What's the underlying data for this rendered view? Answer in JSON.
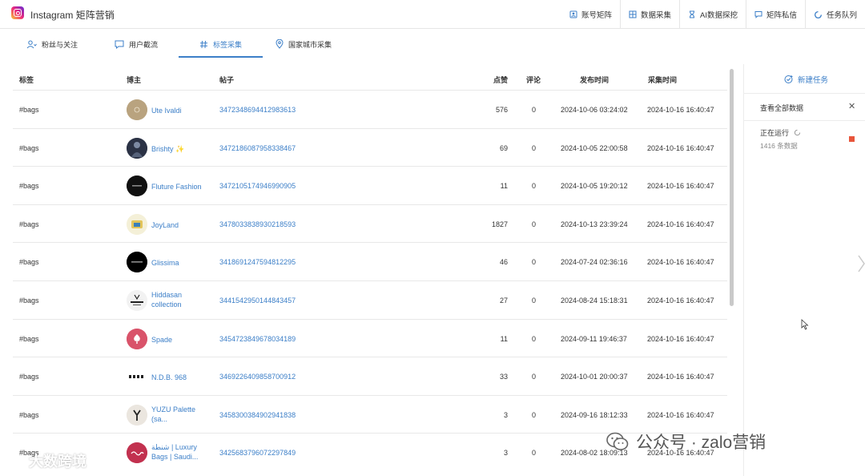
{
  "app": {
    "title": "Instagram 矩阵营销"
  },
  "topnav": [
    {
      "name": "account",
      "label": "账号矩阵"
    },
    {
      "name": "data",
      "label": "数据采集"
    },
    {
      "name": "ai",
      "label": "AI数据探挖"
    },
    {
      "name": "dm",
      "label": "矩阵私信"
    },
    {
      "name": "queue",
      "label": "任务队列"
    }
  ],
  "tabs": [
    {
      "label": "粉丝与关注"
    },
    {
      "label": "用户截流"
    },
    {
      "label": "标签采集"
    },
    {
      "label": "国家城市采集"
    }
  ],
  "table": {
    "headers": {
      "tag": "标签",
      "blogger": "博主",
      "post": "帖子",
      "likes": "点赞",
      "comments": "评论",
      "published": "发布时间",
      "collected": "采集时间"
    },
    "rows": [
      {
        "tag": "#bags",
        "blogger": "Ute Ivaldi",
        "post": "3472348694412983613",
        "likes": "576",
        "comments": "0",
        "published": "2024-10-06 03:24:02",
        "collected": "2024-10-16 16:40:47",
        "avatar_color": "#b9a37f"
      },
      {
        "tag": "#bags",
        "blogger": "Brishty ✨",
        "post": "3472186087958338467",
        "likes": "69",
        "comments": "0",
        "published": "2024-10-05 22:00:58",
        "collected": "2024-10-16 16:40:47",
        "avatar_color": "#2b3245"
      },
      {
        "tag": "#bags",
        "blogger": "Fluture Fashion",
        "post": "3472105174946990905",
        "likes": "11",
        "comments": "0",
        "published": "2024-10-05 19:20:12",
        "collected": "2024-10-16 16:40:47",
        "avatar_color": "#111111"
      },
      {
        "tag": "#bags",
        "blogger": "JoyLand",
        "post": "3478033838930218593",
        "likes": "1827",
        "comments": "0",
        "published": "2024-10-13 23:39:24",
        "collected": "2024-10-16 16:40:47",
        "avatar_color": "#d9c98a"
      },
      {
        "tag": "#bags",
        "blogger": "Glissima",
        "post": "3418691247594812295",
        "likes": "46",
        "comments": "0",
        "published": "2024-07-24 02:36:16",
        "collected": "2024-10-16 16:40:47",
        "avatar_color": "#000000"
      },
      {
        "tag": "#bags",
        "blogger": "Hiddasan collection",
        "post": "3441542950144843457",
        "likes": "27",
        "comments": "0",
        "published": "2024-08-24 15:18:31",
        "collected": "2024-10-16 16:40:47",
        "avatar_color": "#f2f2f2"
      },
      {
        "tag": "#bags",
        "blogger": "Spade",
        "post": "3454723849678034189",
        "likes": "11",
        "comments": "0",
        "published": "2024-09-11 19:46:37",
        "collected": "2024-10-16 16:40:47",
        "avatar_color": "#d9536a"
      },
      {
        "tag": "#bags",
        "blogger": "N.D.B. 968",
        "post": "3469226409858700912",
        "likes": "33",
        "comments": "0",
        "published": "2024-10-01 20:00:37",
        "collected": "2024-10-16 16:40:47",
        "avatar_color": "#ffffff"
      },
      {
        "tag": "#bags",
        "blogger": "YUZU Palette (sa...",
        "post": "3458300384902941838",
        "likes": "3",
        "comments": "0",
        "published": "2024-09-16 18:12:33",
        "collected": "2024-10-16 16:40:47",
        "avatar_color": "#ebe6df"
      },
      {
        "tag": "#bags",
        "blogger": "شنطة | Luxury Bags | Saudi...",
        "post": "3425683796072297849",
        "likes": "3",
        "comments": "0",
        "published": "2024-08-02 18:09:13",
        "collected": "2024-10-16 16:40:47",
        "avatar_color": "#c2314f"
      }
    ]
  },
  "panel": {
    "new_task": "新建任务",
    "view_all": "查看全部数据",
    "status": "正在运行",
    "count": "1416 条数据"
  },
  "watermark": {
    "left": "大数跨境",
    "right": "公众号 · zalo营销"
  },
  "colors": {
    "accent": "#3c7fc8",
    "stop": "#e8553b"
  }
}
